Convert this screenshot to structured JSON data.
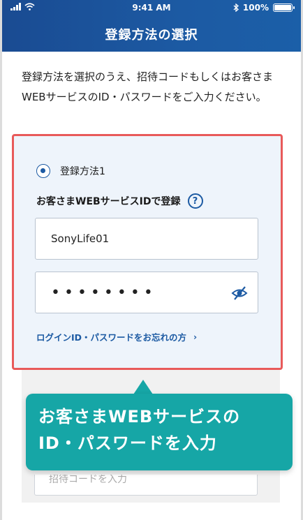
{
  "status_bar": {
    "time": "9:41 AM",
    "battery": "100%",
    "battery_level": 1.0
  },
  "header": {
    "title": "登録方法の選択"
  },
  "intro_text": "登録方法を選択のうえ、招待コードもしくはお客さまWEBサービスのID・パスワードをご入力ください。",
  "method1": {
    "radio_label": "登録方法1",
    "selected": true,
    "section_title": "お客さまWEBサービスIDで登録",
    "help_glyph": "?",
    "id_value": "SonyLife01",
    "password_mask": "••••••••",
    "forgot_link": "ログインID・パスワードをお忘れの方",
    "forgot_chevron": "›"
  },
  "callout": {
    "line1": "お客さまWEBサービスの",
    "line2": "ID・パスワードを入力"
  },
  "hidden_field_placeholder": "招待コードを入力",
  "colors": {
    "header": "#1c5aa3",
    "accent": "#1c5aa3",
    "highlight_border": "#e85a5a",
    "callout": "#16a6a6"
  },
  "icons": {
    "signal": "signal-icon",
    "wifi": "wifi-icon",
    "bluetooth": "bluetooth-icon",
    "battery": "battery-icon",
    "help": "help-icon",
    "eye_slash": "eye-slash-icon"
  }
}
